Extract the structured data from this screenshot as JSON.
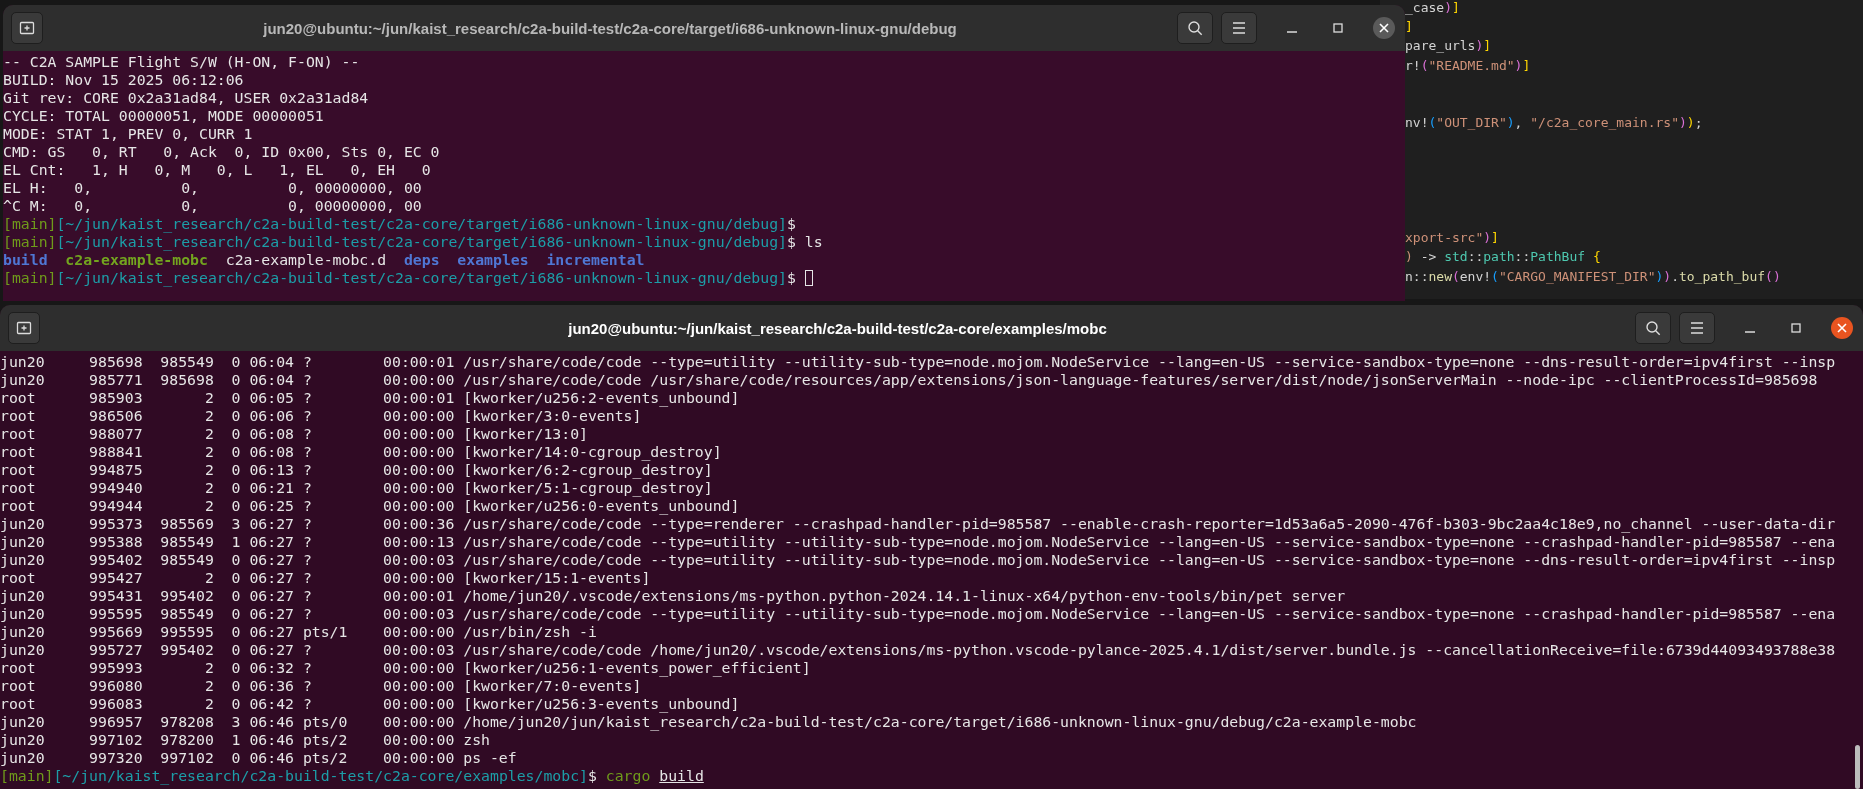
{
  "editor": {
    "lines": [
      {
        "tokens": [
          {
            "text": "_case",
            "kind": "plain"
          },
          {
            "text": ")",
            "kind": "paren"
          },
          {
            "text": "]",
            "kind": "bracket"
          }
        ]
      },
      {
        "tokens": [
          {
            "text": "]",
            "kind": "bracket"
          }
        ]
      },
      {
        "tokens": [
          {
            "text": "pare_urls",
            "kind": "plain"
          },
          {
            "text": ")",
            "kind": "paren"
          },
          {
            "text": "]",
            "kind": "bracket"
          }
        ]
      },
      {
        "tokens": [
          {
            "text": "r!",
            "kind": "plain"
          },
          {
            "text": "(",
            "kind": "paren"
          },
          {
            "text": "\"README.md\"",
            "kind": "string"
          },
          {
            "text": ")",
            "kind": "paren"
          },
          {
            "text": "]",
            "kind": "bracket"
          }
        ]
      },
      {
        "tokens": [
          {
            "text": "nv!",
            "kind": "plain"
          },
          {
            "text": "(",
            "kind": "inner"
          },
          {
            "text": "\"OUT_DIR\"",
            "kind": "string"
          },
          {
            "text": ")",
            "kind": "inner"
          },
          {
            "text": ", ",
            "kind": "plain"
          },
          {
            "text": "\"/c2a_core_main.rs\"",
            "kind": "string"
          },
          {
            "text": ")",
            "kind": "paren"
          },
          {
            "text": ")",
            "kind": "bracket"
          },
          {
            "text": ";",
            "kind": "plain"
          }
        ]
      },
      {
        "tokens": [
          {
            "text": "xport-src\"",
            "kind": "string"
          },
          {
            "text": ")",
            "kind": "paren"
          },
          {
            "text": "]",
            "kind": "bracket"
          }
        ]
      },
      {
        "tokens": [
          {
            "text": ")",
            "kind": "string"
          },
          {
            "text": " -> ",
            "kind": "plain"
          },
          {
            "text": "std",
            "kind": "type"
          },
          {
            "text": "::",
            "kind": "plain"
          },
          {
            "text": "path",
            "kind": "type"
          },
          {
            "text": "::",
            "kind": "plain"
          },
          {
            "text": "PathBuf ",
            "kind": "type"
          },
          {
            "text": "{",
            "kind": "bracket"
          }
        ]
      },
      {
        "tokens": [
          {
            "text": "n::",
            "kind": "plain"
          },
          {
            "text": "new",
            "kind": "func"
          },
          {
            "text": "(",
            "kind": "paren"
          },
          {
            "text": "env!",
            "kind": "plain"
          },
          {
            "text": "(",
            "kind": "inner"
          },
          {
            "text": "\"CARGO_MANIFEST_DIR\"",
            "kind": "string"
          },
          {
            "text": ")",
            "kind": "inner"
          },
          {
            "text": ")",
            "kind": "paren"
          },
          {
            "text": ".",
            "kind": "plain"
          },
          {
            "text": "to_path_buf",
            "kind": "func"
          },
          {
            "text": "()",
            "kind": "paren"
          }
        ]
      }
    ]
  },
  "terminals": [
    {
      "title": "jun20@ubuntu:~/jun/kaist_research/c2a-build-test/c2a-core/target/i686-unknown-linux-gnu/debug",
      "focused": false,
      "lines": [
        {
          "spans": [
            {
              "text": "-- C2A SAMPLE Flight S/W (H-ON, F-ON) --",
              "kind": "plain"
            }
          ]
        },
        {
          "spans": [
            {
              "text": "BUILD: Nov 15 2025 06:12:06",
              "kind": "plain"
            }
          ]
        },
        {
          "spans": [
            {
              "text": "Git rev: CORE 0x2a31ad84, USER 0x2a31ad84",
              "kind": "plain"
            }
          ]
        },
        {
          "spans": [
            {
              "text": "CYCLE: TOTAL 00000051, MODE 00000051",
              "kind": "plain"
            }
          ]
        },
        {
          "spans": [
            {
              "text": "MODE: STAT 1, PREV 0, CURR 1",
              "kind": "plain"
            }
          ]
        },
        {
          "spans": [
            {
              "text": "CMD: GS   0, RT   0, Ack  0, ID 0x00, Sts 0, EC 0",
              "kind": "plain"
            }
          ]
        },
        {
          "spans": [
            {
              "text": "EL Cnt:   1, H   0, M   0, L   1, EL   0, EH   0",
              "kind": "plain"
            }
          ]
        },
        {
          "spans": [
            {
              "text": "EL H:   0,          0,          0, 00000000, 00",
              "kind": "plain"
            }
          ]
        },
        {
          "spans": [
            {
              "text": "^C M:   0,          0,          0, 00000000, 00",
              "kind": "plain"
            }
          ]
        },
        {
          "spans": [
            {
              "text": "[main]",
              "kind": "branch"
            },
            {
              "text": "[~/jun/kaist_research/c2a-build-test/c2a-core/target/i686-unknown-linux-gnu/debug]",
              "kind": "path"
            },
            {
              "text": "$",
              "kind": "plain"
            }
          ]
        },
        {
          "spans": [
            {
              "text": "[main]",
              "kind": "branch"
            },
            {
              "text": "[~/jun/kaist_research/c2a-build-test/c2a-core/target/i686-unknown-linux-gnu/debug]",
              "kind": "path"
            },
            {
              "text": "$ ls",
              "kind": "plain"
            }
          ]
        },
        {
          "spans": [
            {
              "text": "build",
              "kind": "dir"
            },
            {
              "text": "  c2a-example-mobc",
              "kind": "exec"
            },
            {
              "text": "  c2a-example-mobc.d  ",
              "kind": "plain"
            },
            {
              "text": "deps",
              "kind": "dir"
            },
            {
              "text": "  examples",
              "kind": "dir"
            },
            {
              "text": "  incremental",
              "kind": "dir"
            }
          ]
        },
        {
          "spans": [
            {
              "text": "[main]",
              "kind": "branch"
            },
            {
              "text": "[~/jun/kaist_research/c2a-build-test/c2a-core/target/i686-unknown-linux-gnu/debug]",
              "kind": "path"
            },
            {
              "text": "$ ",
              "kind": "plain"
            }
          ],
          "cursor": true
        }
      ]
    },
    {
      "title": "jun20@ubuntu:~/jun/kaist_research/c2a-build-test/c2a-core/examples/mobc",
      "focused": true,
      "lines": [
        {
          "spans": [
            {
              "text": "jun20     985698  985549  0 06:04 ?        00:00:01 /usr/share/code/code --type=utility --utility-sub-type=node.mojom.NodeService --lang=en-US --service-sandbox-type=none --dns-result-order=ipv4first --insp",
              "kind": "plain"
            }
          ]
        },
        {
          "spans": [
            {
              "text": "jun20     985771  985698  0 06:04 ?        00:00:00 /usr/share/code/code /usr/share/code/resources/app/extensions/json-language-features/server/dist/node/jsonServerMain --node-ipc --clientProcessId=985698",
              "kind": "plain"
            }
          ]
        },
        {
          "spans": [
            {
              "text": "root      985903       2  0 06:05 ?        00:00:01 [kworker/u256:2-events_unbound]",
              "kind": "plain"
            }
          ]
        },
        {
          "spans": [
            {
              "text": "root      986506       2  0 06:06 ?        00:00:00 [kworker/3:0-events]",
              "kind": "plain"
            }
          ]
        },
        {
          "spans": [
            {
              "text": "root      988077       2  0 06:08 ?        00:00:00 [kworker/13:0]",
              "kind": "plain"
            }
          ]
        },
        {
          "spans": [
            {
              "text": "root      988841       2  0 06:08 ?        00:00:00 [kworker/14:0-cgroup_destroy]",
              "kind": "plain"
            }
          ]
        },
        {
          "spans": [
            {
              "text": "root      994875       2  0 06:13 ?        00:00:00 [kworker/6:2-cgroup_destroy]",
              "kind": "plain"
            }
          ]
        },
        {
          "spans": [
            {
              "text": "root      994940       2  0 06:21 ?        00:00:00 [kworker/5:1-cgroup_destroy]",
              "kind": "plain"
            }
          ]
        },
        {
          "spans": [
            {
              "text": "root      994944       2  0 06:25 ?        00:00:00 [kworker/u256:0-events_unbound]",
              "kind": "plain"
            }
          ]
        },
        {
          "spans": [
            {
              "text": "jun20     995373  985569  3 06:27 ?        00:00:36 /usr/share/code/code --type=renderer --crashpad-handler-pid=985587 --enable-crash-reporter=1d53a6a5-2090-476f-b303-9bc2aa4c18e9,no_channel --user-data-dir",
              "kind": "plain"
            }
          ]
        },
        {
          "spans": [
            {
              "text": "jun20     995388  985549  1 06:27 ?        00:00:13 /usr/share/code/code --type=utility --utility-sub-type=node.mojom.NodeService --lang=en-US --service-sandbox-type=none --crashpad-handler-pid=985587 --ena",
              "kind": "plain"
            }
          ]
        },
        {
          "spans": [
            {
              "text": "jun20     995402  985549  0 06:27 ?        00:00:03 /usr/share/code/code --type=utility --utility-sub-type=node.mojom.NodeService --lang=en-US --service-sandbox-type=none --dns-result-order=ipv4first --insp",
              "kind": "plain"
            }
          ]
        },
        {
          "spans": [
            {
              "text": "root      995427       2  0 06:27 ?        00:00:00 [kworker/15:1-events]",
              "kind": "plain"
            }
          ]
        },
        {
          "spans": [
            {
              "text": "jun20     995431  995402  0 06:27 ?        00:00:01 /home/jun20/.vscode/extensions/ms-python.python-2024.14.1-linux-x64/python-env-tools/bin/pet server",
              "kind": "plain"
            }
          ]
        },
        {
          "spans": [
            {
              "text": "jun20     995595  985549  0 06:27 ?        00:00:03 /usr/share/code/code --type=utility --utility-sub-type=node.mojom.NodeService --lang=en-US --service-sandbox-type=none --crashpad-handler-pid=985587 --ena",
              "kind": "plain"
            }
          ]
        },
        {
          "spans": [
            {
              "text": "jun20     995669  995595  0 06:27 pts/1    00:00:00 /usr/bin/zsh -i",
              "kind": "plain"
            }
          ]
        },
        {
          "spans": [
            {
              "text": "jun20     995727  995402  0 06:27 ?        00:00:03 /usr/share/code/code /home/jun20/.vscode/extensions/ms-python.vscode-pylance-2025.4.1/dist/server.bundle.js --cancellationReceive=file:6739d44093493788e38",
              "kind": "plain"
            }
          ]
        },
        {
          "spans": [
            {
              "text": "root      995993       2  0 06:32 ?        00:00:00 [kworker/u256:1-events_power_efficient]",
              "kind": "plain"
            }
          ]
        },
        {
          "spans": [
            {
              "text": "root      996080       2  0 06:36 ?        00:00:00 [kworker/7:0-events]",
              "kind": "plain"
            }
          ]
        },
        {
          "spans": [
            {
              "text": "root      996083       2  0 06:42 ?        00:00:00 [kworker/u256:3-events_unbound]",
              "kind": "plain"
            }
          ]
        },
        {
          "spans": [
            {
              "text": "jun20     996957  978208  3 06:46 pts/0    00:00:00 /home/jun20/jun/kaist_research/c2a-build-test/c2a-core/target/i686-unknown-linux-gnu/debug/c2a-example-mobc",
              "kind": "plain"
            }
          ]
        },
        {
          "spans": [
            {
              "text": "jun20     997102  978200  1 06:46 pts/2    00:00:00 zsh",
              "kind": "plain"
            }
          ]
        },
        {
          "spans": [
            {
              "text": "jun20     997320  997102  0 06:46 pts/2    00:00:00 ps -ef",
              "kind": "plain"
            }
          ]
        },
        {
          "spans": [
            {
              "text": "[main]",
              "kind": "branch"
            },
            {
              "text": "[~/jun/kaist_research/c2a-build-test/c2a-core/examples/mobc]",
              "kind": "path"
            },
            {
              "text": "$ ",
              "kind": "plain"
            },
            {
              "text": "cargo ",
              "kind": "command"
            },
            {
              "text": "build",
              "kind": "arg"
            }
          ]
        }
      ]
    }
  ]
}
